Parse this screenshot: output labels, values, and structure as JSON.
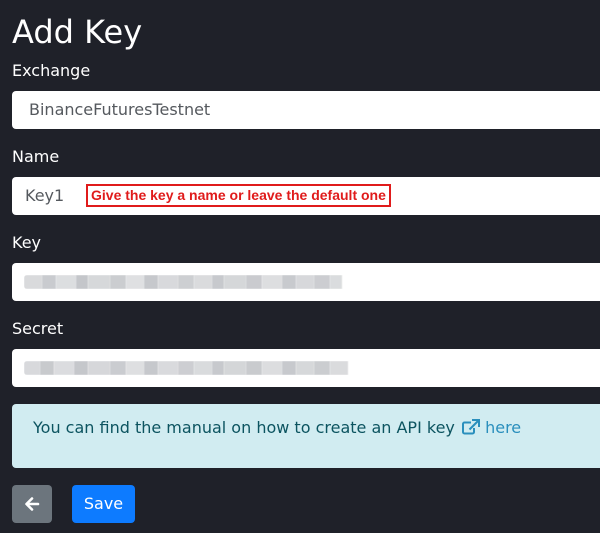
{
  "page": {
    "title": "Add Key"
  },
  "form": {
    "exchange": {
      "label": "Exchange",
      "value": "BinanceFuturesTestnet"
    },
    "name": {
      "label": "Name",
      "value": "Key1",
      "annotation": "Give the key a name or leave the default one"
    },
    "key": {
      "label": "Key",
      "value_state": "blurred"
    },
    "secret": {
      "label": "Secret",
      "value_state": "blurred"
    }
  },
  "info": {
    "text": "You can find the manual on how to create an API key",
    "link_label": "here",
    "link_icon": "external-link-icon"
  },
  "buttons": {
    "back_icon": "arrow-left-icon",
    "save_label": "Save"
  },
  "colors": {
    "background": "#1f2129",
    "annotation": "#e01b1b",
    "info_background": "#d1ecf1",
    "info_text": "#0c5460",
    "link": "#2a8fbd",
    "save_button": "#0d7bff",
    "back_button": "#6c757d"
  }
}
